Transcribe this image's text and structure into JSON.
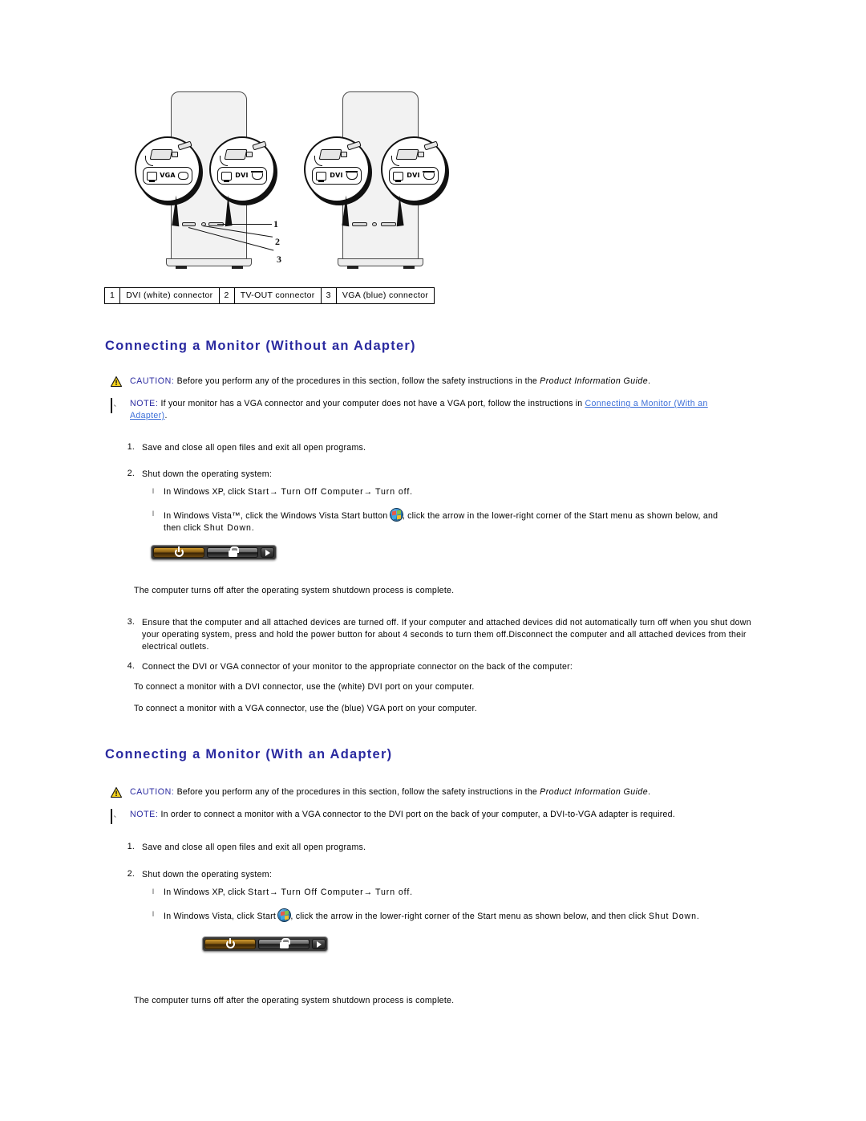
{
  "figure": {
    "name": "monitor-connector-diagram",
    "left_tower_callouts": [
      "VGA",
      "DVI"
    ],
    "right_tower_callouts": [
      "DVI",
      "DVI"
    ],
    "port_icon_label": "MONITOR",
    "callout_numbers": [
      "1",
      "2",
      "3"
    ]
  },
  "legend": {
    "rows": [
      {
        "num": "1",
        "label": "DVI (white) connector"
      },
      {
        "num": "2",
        "label": "TV-OUT connector"
      },
      {
        "num": "3",
        "label": "VGA (blue) connector"
      }
    ]
  },
  "section_without": {
    "heading": "Connecting a Monitor (Without an Adapter)",
    "caution": {
      "keyword": "CAUTION:",
      "text_before": " Before you perform any of the procedures in this section, follow the safety instructions in the ",
      "italic": "Product Information Guide",
      "text_after": "."
    },
    "note": {
      "keyword": "NOTE:",
      "text_before": " If your monitor has a VGA connector and your computer does not have a VGA port, follow the instructions in ",
      "link": "Connecting a Monitor (With an",
      "link_wrap": "Adapter)",
      "text_after": "."
    },
    "step1": {
      "num": "1.",
      "text": "Save and close all open files and exit all open programs."
    },
    "step2": {
      "num": "2.",
      "text": "Shut down the operating system:"
    },
    "bullet_xp": {
      "marker": "l",
      "text_a": "In Windows XP, click ",
      "bold_a": "Start",
      "arrow1": "→",
      "bold_b": " Turn Off Computer",
      "arrow2": "→",
      "bold_c": " Turn off",
      "text_end": "."
    },
    "bullet_vista": {
      "marker": "l",
      "text_a": "In Windows Vista™, click the Windows Vista Start button",
      "icon": "windows-vista-orb-icon",
      "text_b": ", click the arrow in the lower-right corner of the Start menu as shown below, and",
      "text_c": "then click ",
      "bold_c": "Shut Down",
      "text_d": "."
    },
    "shutdown_widget": {
      "name": "vista-shutdown-bar",
      "power_icon": "power-icon",
      "lock_icon": "lock-icon",
      "arrow_icon": "arrow-right-icon"
    },
    "after_shutdown": "The computer turns off after the operating system shutdown process is complete.",
    "step3": {
      "num": "3.",
      "text": "Ensure that the computer and all attached devices are turned off. If your computer and attached devices did not automatically turn off when you shut down your operating system, press and hold the power button for about 4 seconds to turn them off.Disconnect the computer and all attached devices from their electrical outlets."
    },
    "step4": {
      "num": "4.",
      "text": "Connect the DVI or VGA connector of your monitor to the appropriate connector on the back of the computer:"
    },
    "dvi_line": "To connect a monitor with a DVI connector, use the (white) DVI port on your computer.",
    "vga_line": "To connect a monitor with a VGA connector, use the (blue) VGA port on your computer."
  },
  "section_with": {
    "heading": "Connecting a Monitor (With an Adapter)",
    "caution": {
      "keyword": "CAUTION:",
      "text_before": " Before you perform any of the procedures in this section, follow the safety instructions in the ",
      "italic": "Product Information Guide",
      "text_after": "."
    },
    "note": {
      "keyword": "NOTE:",
      "text": " In order to connect a monitor with a VGA connector to the DVI port on the back of your computer, a DVI-to-VGA adapter is required."
    },
    "step1": {
      "num": "1.",
      "text": "Save and close all open files and exit all open programs."
    },
    "step2": {
      "num": "2.",
      "text": "Shut down the operating system:"
    },
    "bullet_xp": {
      "marker": "l",
      "text_a": "In Windows XP, click ",
      "bold_a": "Start",
      "arrow1": "→",
      "bold_b": " Turn Off Computer",
      "arrow2": "→",
      "bold_c": " Turn off",
      "text_end": "."
    },
    "bullet_vista": {
      "marker": "l",
      "text_a": "In Windows Vista, click Start",
      "icon": "windows-vista-orb-icon",
      "text_b": ", click the arrow in the lower-right corner of the Start menu as shown below, and then click ",
      "bold_b": "Shut Down",
      "text_c": "."
    },
    "shutdown_widget": {
      "name": "vista-shutdown-bar",
      "power_icon": "power-icon",
      "lock_icon": "lock-icon",
      "arrow_icon": "arrow-right-icon"
    },
    "after_shutdown": "The computer turns off after the operating system shutdown process is complete."
  },
  "icons": {
    "caution": "warning-triangle-icon",
    "note": "note-pencil-icon"
  },
  "colors": {
    "heading": "#2A2AA0",
    "keyword": "#2A2AA0",
    "link": "#3C6FD8",
    "caution_fill": "#F5D21E",
    "background": "#FFFFFF"
  }
}
